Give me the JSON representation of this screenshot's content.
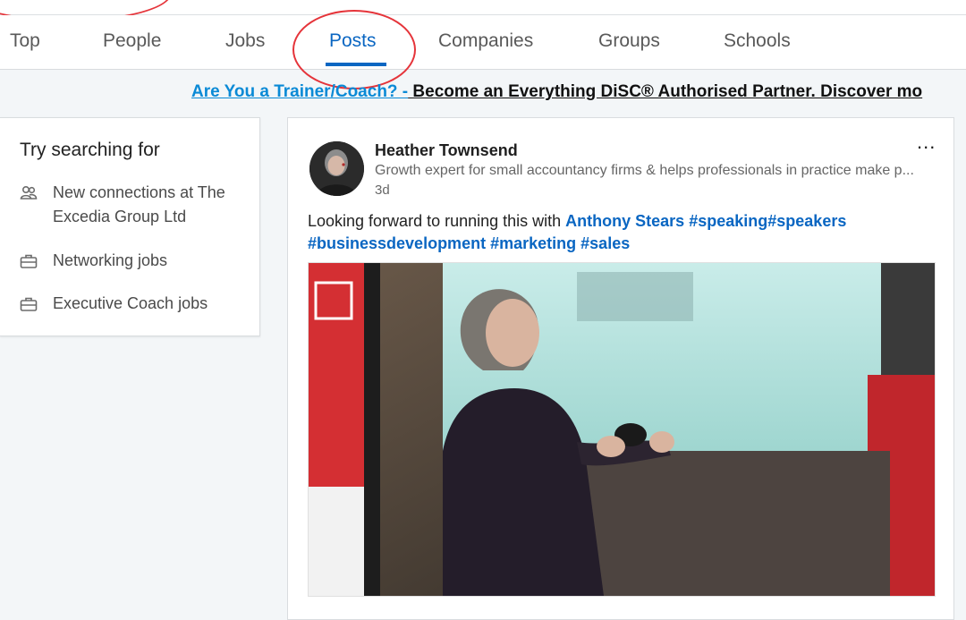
{
  "tabs": [
    {
      "label": "Top"
    },
    {
      "label": "People"
    },
    {
      "label": "Jobs"
    },
    {
      "label": "Posts",
      "active": true
    },
    {
      "label": "Companies"
    },
    {
      "label": "Groups"
    },
    {
      "label": "Schools"
    }
  ],
  "promo": {
    "link_text": "Are You a Trainer/Coach? -",
    "rest_text": " Become an Everything DiSC® Authorised Partner. Discover mo"
  },
  "sidebar": {
    "title": "Try searching for",
    "items": [
      {
        "label": "New connections at The Excedia Group Ltd",
        "icon": "people-icon"
      },
      {
        "label": "Networking jobs",
        "icon": "briefcase-icon"
      },
      {
        "label": "Executive Coach jobs",
        "icon": "briefcase-icon"
      }
    ]
  },
  "post": {
    "author": "Heather Townsend",
    "headline": "Growth expert for small accountancy firms & helps professionals in practice make p...",
    "age": "3d",
    "more_label": "...",
    "text_prefix": "Looking forward to running this with ",
    "mention": "Anthony Stears",
    "hashtags": [
      "#speaking",
      "#speakers",
      "#businessdevelopment",
      "#marketing",
      "#sales"
    ]
  },
  "colors": {
    "accent": "#0a66c2",
    "annotation": "#e5343a",
    "promo_link": "#0a8ad6"
  }
}
